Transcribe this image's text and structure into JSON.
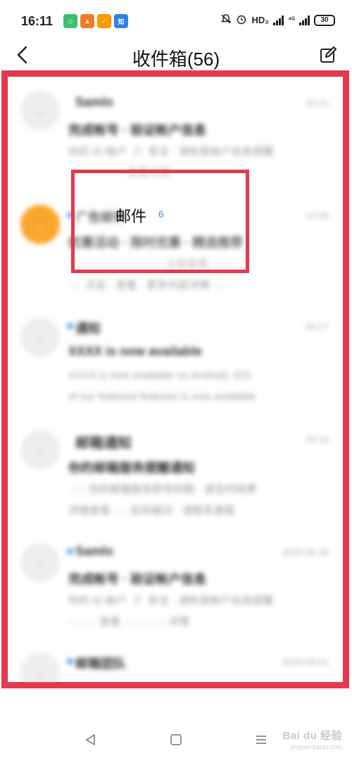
{
  "status_bar": {
    "time": "16:11",
    "app_icons": [
      {
        "name": "green-app-icon",
        "color": "#3cbf6e",
        "glyph": "◇"
      },
      {
        "name": "orange-app-icon",
        "color": "#f07c25",
        "glyph": "▲"
      },
      {
        "name": "shop-app-icon",
        "color": "#ff9800",
        "glyph": "✓"
      },
      {
        "name": "blue-app-icon",
        "color": "#2f7fe8",
        "glyph": "知"
      }
    ],
    "hd_label": "HD₂",
    "network_1": "⁴ᴳ",
    "network_2": "⁴ᴳ",
    "battery": "30"
  },
  "header": {
    "title": "收件箱(56)"
  },
  "mail_list": [
    {
      "avatar": "...",
      "avatar_color": "#eeeeee",
      "unread": false,
      "sender": "Samlo",
      "date": "10-21",
      "subject": "完成帐号 · 验证帐户信息",
      "preview_1": "你的 ID 帐户（）安全 · 请检查帐户信息提醒",
      "preview_2": "················ 查看详情"
    },
    {
      "avatar": "...",
      "avatar_color": "#f8a52b",
      "unread": true,
      "sender": "广告邮件",
      "date": "10-09",
      "subject": "优惠活动 · 限时优惠 · 精选推荐",
      "preview_1": "··························· 立即查看 ·······",
      "preview_2": "···· 点击 · 查看 · 更多内容详情 ······"
    },
    {
      "avatar": "...",
      "avatar_color": "#eeeeee",
      "unread": true,
      "sender": "通知",
      "date": "09-27",
      "subject": "XXXX is now available",
      "preview_1": "XXXX is now available on Android, iOS",
      "preview_2": "of our featured features is now available"
    },
    {
      "avatar": "...",
      "avatar_color": "#eeeeee",
      "unread": false,
      "sender": "邮箱通知",
      "date": "09-19",
      "subject": "你的邮箱服务提醒通知",
      "preview_1": "····· 你的邮箱服务即将到期 · 请及时续费",
      "preview_2": "详情查看 ···· 如有疑问 · 请联系客服"
    },
    {
      "avatar": "...",
      "avatar_color": "#eeeeee",
      "unread": true,
      "sender": "Samlo",
      "date": "2020-08-28",
      "subject": "完成帐号 · 验证帐户信息",
      "preview_1": "你的 ID 帐户（）安全 · 请检查帐户信息提醒",
      "preview_2": "········ 查看 ············ 详情"
    },
    {
      "avatar": "...",
      "avatar_color": "#eeeeee",
      "unread": true,
      "sender": "邮箱团队",
      "date": "2020-08-01",
      "subject": "",
      "preview_1": "",
      "preview_2": ""
    }
  ],
  "highlight": {
    "label": "邮件",
    "count": "6",
    "border_color": "#e23a4e"
  },
  "nav_bar": {
    "back": "back-triangle-icon",
    "home": "home-square-icon",
    "menu": "menu-lines-icon"
  },
  "watermark": {
    "text": "Bai du 经验",
    "sub": "jingyan.baidu.com"
  }
}
